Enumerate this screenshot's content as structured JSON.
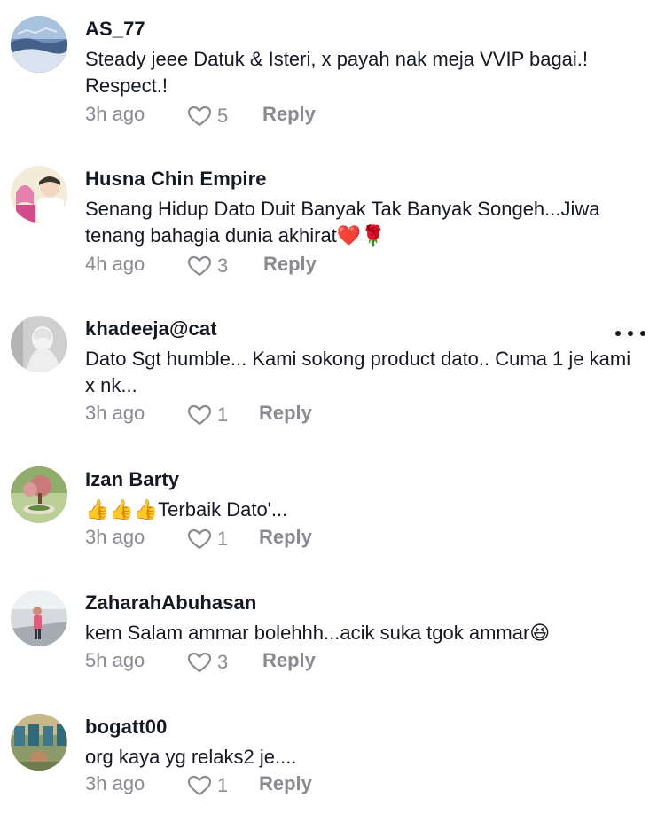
{
  "comments": [
    {
      "username": "AS_77",
      "text": "Steady jeee Datuk & Isteri, x payah nak meja VVIP bagai.! Respect.!",
      "time": "3h ago",
      "likes": "5",
      "reply_label": "Reply"
    },
    {
      "username": "Husna  Chin  Empire",
      "text": "Senang Hidup Dato Duit Banyak Tak Banyak Songeh...Jiwa tenang bahagia dunia akhirat❤️🌹",
      "time": "4h ago",
      "likes": "3",
      "reply_label": "Reply"
    },
    {
      "username": "khadeeja@cat",
      "text": "Dato Sgt humble... Kami sokong product dato.. Cuma 1 je kami x nk...",
      "time": "3h ago",
      "likes": "1",
      "reply_label": "Reply"
    },
    {
      "username": "Izan Barty",
      "text": "👍👍👍Terbaik Dato'...",
      "time": "3h ago",
      "likes": "1",
      "reply_label": "Reply"
    },
    {
      "username": "ZaharahAbuhasan",
      "text": "kem Salam ammar bolehhh...acik suka tgok ammar😆",
      "time": "5h ago",
      "likes": "3",
      "reply_label": "Reply"
    },
    {
      "username": "bogatt00",
      "text": "org kaya yg relaks2 je....",
      "time": "3h ago",
      "likes": "1",
      "reply_label": "Reply"
    }
  ],
  "icons": {
    "like": "heart-outline-icon",
    "more": "more-horizontal-icon"
  },
  "colors": {
    "text": "#161823",
    "secondary": "#8a8b91"
  }
}
